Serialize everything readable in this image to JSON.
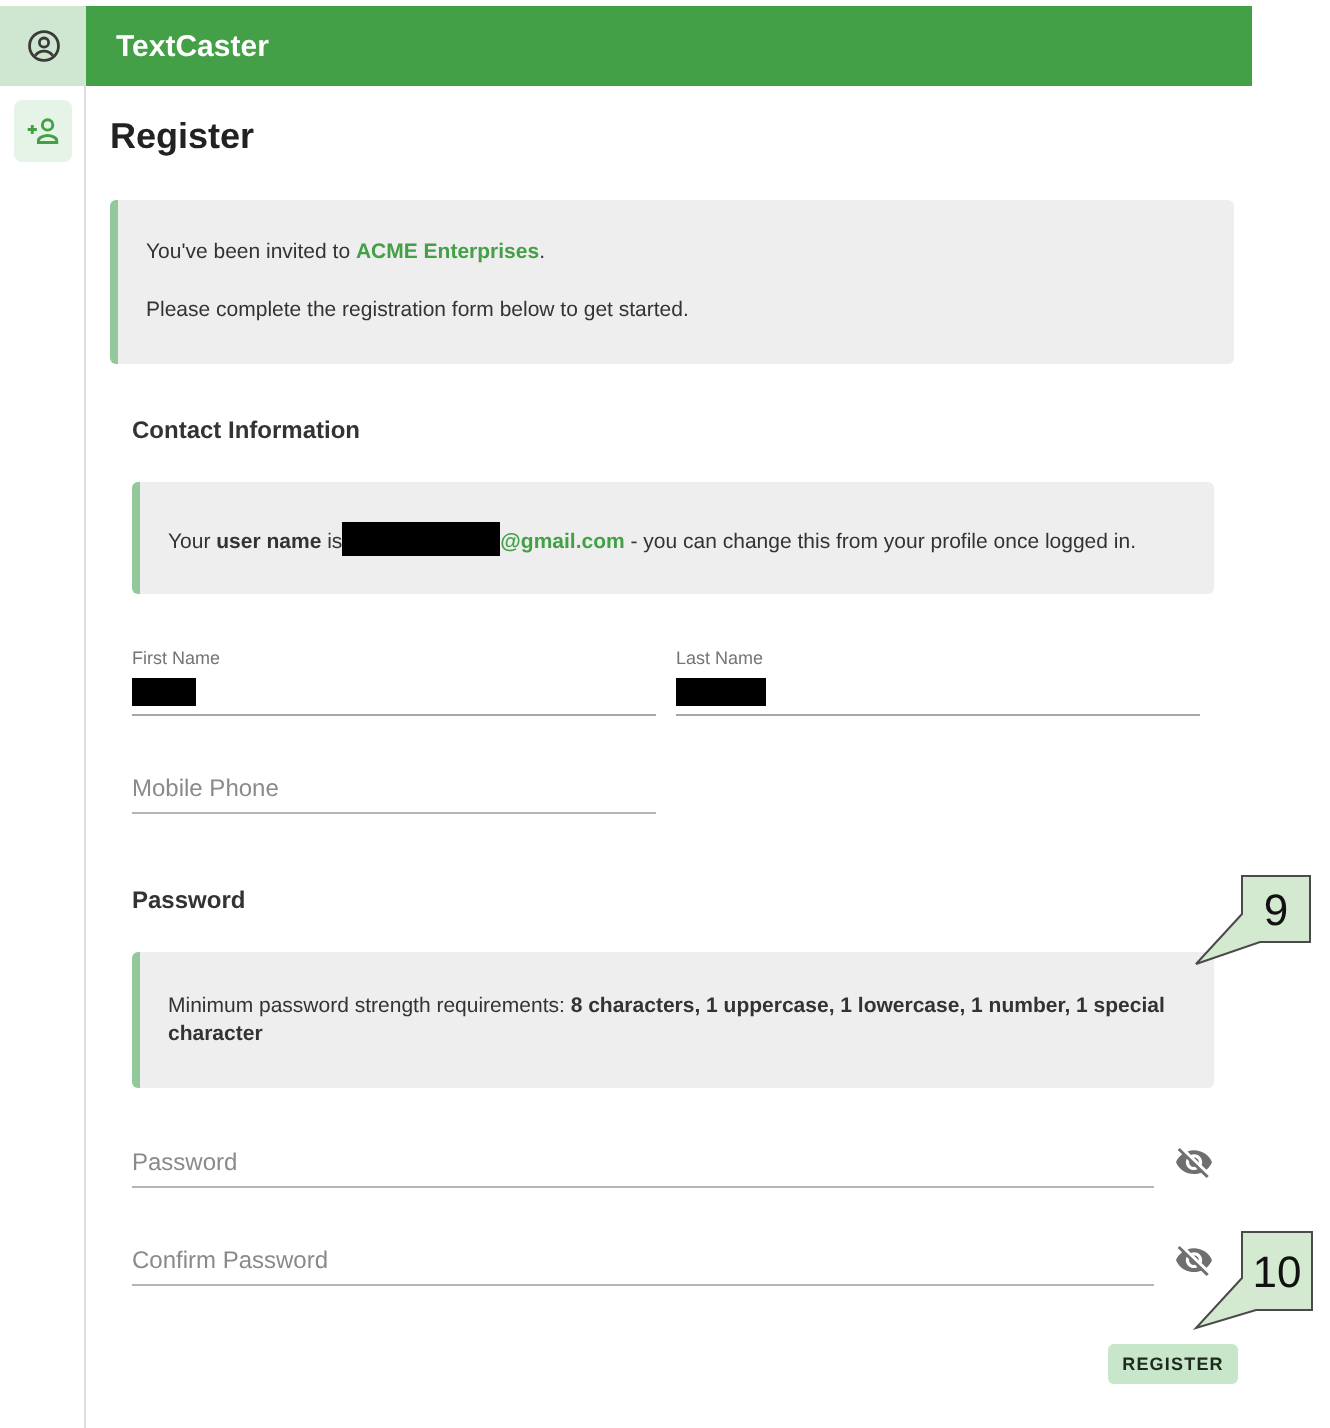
{
  "app_bar": {
    "title": "TextCaster"
  },
  "nav": {
    "items": [
      {
        "selected": true
      }
    ]
  },
  "page_title": "Register",
  "invite_notice": {
    "lines": [
      [
        {
          "kind": "text",
          "text": "You've been invited to "
        },
        {
          "kind": "highlight",
          "text": "ACME Enterprises"
        },
        {
          "kind": "text",
          "text": "."
        }
      ],
      [
        {
          "kind": "text",
          "text": "Please complete the registration form below to get started."
        }
      ]
    ]
  },
  "contact_section": {
    "heading": "Contact Information",
    "notice": {
      "segments": [
        {
          "kind": "text",
          "text": "Your "
        },
        {
          "kind": "bold",
          "text": "user name"
        },
        {
          "kind": "text",
          "text": " is"
        },
        {
          "kind": "redacted"
        },
        {
          "kind": "highlight",
          "text": "@gmail.com"
        },
        {
          "kind": "text",
          "text": " - you can change this from your profile once logged in."
        }
      ]
    },
    "fields": [
      {
        "label": "First Name",
        "redacted": true
      },
      {
        "label": "Last Name",
        "redacted": true
      }
    ],
    "phone_field": {
      "placeholder": "Mobile Phone"
    }
  },
  "password_section": {
    "heading": "Password",
    "notice": {
      "segments": [
        {
          "kind": "text",
          "text": "Minimum password strength requirements: "
        },
        {
          "kind": "bold",
          "text": "8 characters, 1 uppercase, 1 lowercase, 1 number, 1 special character"
        }
      ],
      "callout": "9"
    },
    "fields": [
      {
        "placeholder": "Password",
        "show_password": false
      },
      {
        "placeholder": "Confirm Password",
        "show_password": false
      }
    ]
  },
  "register_button": {
    "label": "REGISTER",
    "callout": "10"
  }
}
